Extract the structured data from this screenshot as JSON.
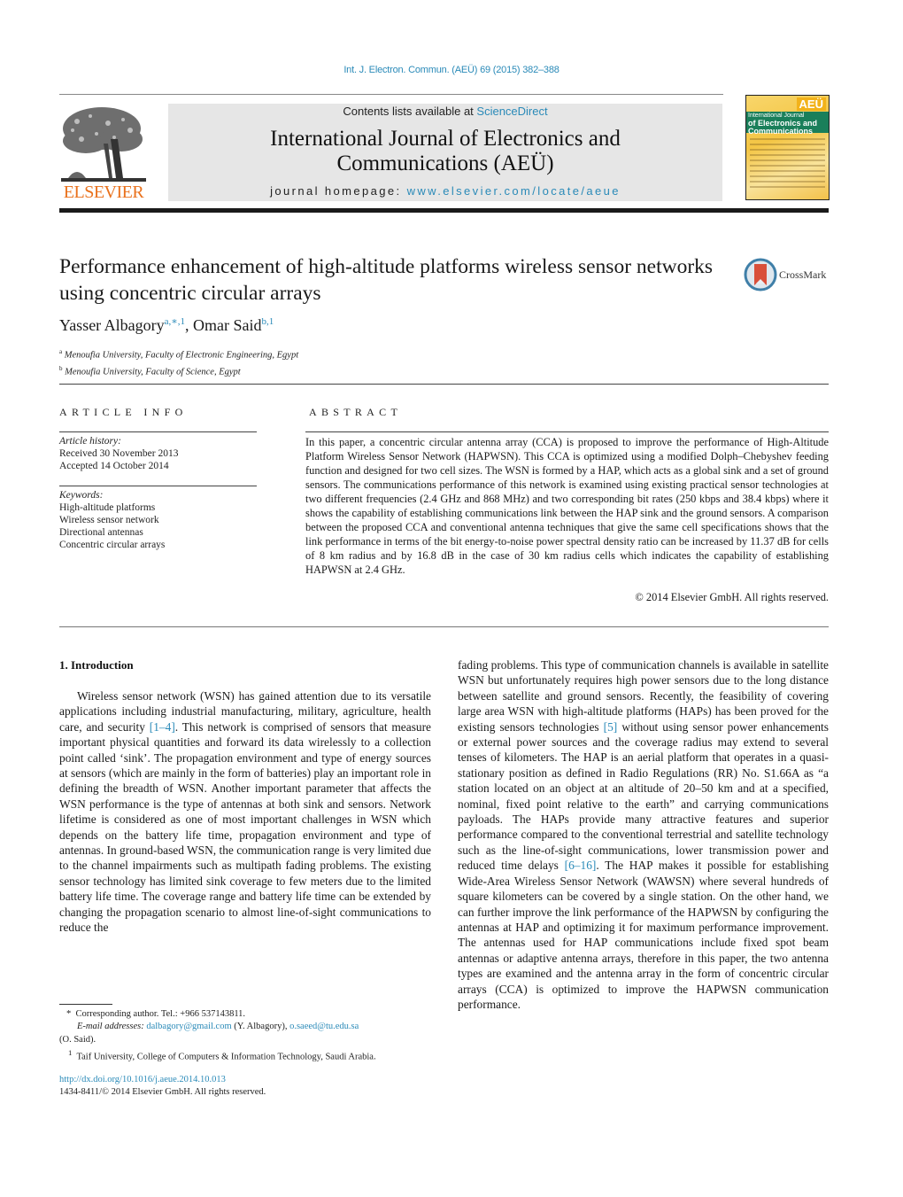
{
  "header": {
    "citation": "Int. J. Electron. Commun. (AEÜ) 69 (2015) 382–388",
    "contents_prefix": "Contents lists available at ",
    "contents_link": "ScienceDirect",
    "journal_title_line1": "International Journal of Electronics and",
    "journal_title_line2": "Communications (AEÜ)",
    "homepage_prefix": "journal homepage: ",
    "homepage_link": "www.elsevier.com/locate/aeue",
    "publisher_logo_text": "ELSEVIER",
    "cover": {
      "badge": "AEÜ",
      "small_title": "International Journal",
      "big_title_line1": "of Electronics and",
      "big_title_line2": "Communications"
    }
  },
  "article": {
    "title": "Performance enhancement of high-altitude platforms wireless sensor networks using concentric circular arrays",
    "crossmark_label": "CrossMark",
    "authors": [
      {
        "name": "Yasser Albagory",
        "marks": "a,∗,1"
      },
      {
        "name": "Omar Said",
        "marks": "b,1"
      }
    ],
    "author_separator": ", ",
    "affiliations": [
      {
        "mark": "a",
        "text": "Menoufia University, Faculty of Electronic Engineering, Egypt"
      },
      {
        "mark": "b",
        "text": "Menoufia University, Faculty of Science, Egypt"
      }
    ]
  },
  "article_info": {
    "heading": "ARTICLE INFO",
    "history_label": "Article history:",
    "received": "Received 30 November 2013",
    "accepted": "Accepted 14 October 2014",
    "keywords_label": "Keywords:",
    "keywords": [
      "High-altitude platforms",
      "Wireless sensor network",
      "Directional antennas",
      "Concentric circular arrays"
    ]
  },
  "abstract": {
    "heading": "ABSTRACT",
    "text": "In this paper, a concentric circular antenna array (CCA) is proposed to improve the performance of High-Altitude Platform Wireless Sensor Network (HAPWSN). This CCA is optimized using a modified Dolph–Chebyshev feeding function and designed for two cell sizes. The WSN is formed by a HAP, which acts as a global sink and a set of ground sensors. The communications performance of this network is examined using existing practical sensor technologies at two different frequencies (2.4 GHz and 868 MHz) and two corresponding bit rates (250 kbps and 38.4 kbps) where it shows the capability of establishing communications link between the HAP sink and the ground sensors. A comparison between the proposed CCA and conventional antenna techniques that give the same cell specifications shows that the link performance in terms of the bit energy-to-noise power spectral density ratio can be increased by 11.37 dB for cells of 8 km radius and by 16.8 dB in the case of 30 km radius cells which indicates the capability of establishing HAPWSN at 2.4 GHz.",
    "copyright": "© 2014 Elsevier GmbH. All rights reserved."
  },
  "body": {
    "section_heading": "1.  Introduction",
    "left_column": {
      "p1_part1": "Wireless sensor network (WSN) has gained attention due to its versatile applications including industrial manufacturing, military, agriculture, health care, and security ",
      "ref1": "[1–4]",
      "p1_part2": ". This network is comprised of sensors that measure important physical quantities and forward its data wirelessly to a collection point called ‘sink’. The propagation environment and type of energy sources at sensors (which are mainly in the form of batteries) play an important role in defining the breadth of WSN. Another important parameter that affects the WSN performance is the type of antennas at both sink and sensors. Network lifetime is considered as one of most important challenges in WSN which depends on the battery life time, propagation environment and type of antennas. In ground-based WSN, the communication range is very limited due to the channel impairments such as multipath fading problems. The existing sensor technology has limited sink coverage to few meters due to the limited battery life time. The coverage range and battery life time can be extended by changing the propagation scenario to almost line-of-sight communications to reduce the"
    },
    "right_column": {
      "part1": "fading problems. This type of communication channels is available in satellite WSN but unfortunately requires high power sensors due to the long distance between satellite and ground sensors. Recently, the feasibility of covering large area WSN with high-altitude platforms (HAPs) has been proved for the existing sensors technologies ",
      "ref5": "[5]",
      "part2": " without using sensor power enhancements or external power sources and the coverage radius may extend to several tenses of kilometers. The HAP is an aerial platform that operates in a quasi-stationary position as defined in Radio Regulations (RR) No. S1.66A as “a station located on an object at an altitude of 20–50 km and at a specified, nominal, fixed point relative to the earth” and carrying communications payloads. The HAPs provide many attractive features and superior performance compared to the conventional terrestrial and satellite technology such as the line-of-sight communications, lower transmission power and reduced time delays ",
      "ref6": "[6–16]",
      "part3": ". The HAP makes it possible for establishing Wide-Area Wireless Sensor Network (WAWSN) where several hundreds of square kilometers can be covered by a single station. On the other hand, we can further improve the link performance of the HAPWSN by configuring the antennas at HAP and optimizing it for maximum performance improvement. The antennas used for HAP communications include fixed spot beam antennas or adaptive antenna arrays, therefore in this paper, the two antenna types are examined and the antenna array in the form of concentric circular arrays (CCA) is optimized to improve the HAPWSN communication performance."
    }
  },
  "footnotes": {
    "corresponding_mark": "*",
    "corresponding": "Corresponding author. Tel.: +966 537143811.",
    "email_label": "E-mail addresses:",
    "email1": "dalbagory@gmail.com",
    "email1_owner": " (Y. Albagory), ",
    "email2": "o.saeed@tu.edu.sa",
    "email2_owner": "(O. Said).",
    "note1_mark": "1",
    "note1": "Taif University, College of Computers & Information Technology, Saudi Arabia.",
    "doi_link": "http://dx.doi.org/10.1016/j.aeue.2014.10.013",
    "issn_line": "1434-8411/© 2014 Elsevier GmbH. All rights reserved."
  },
  "colors": {
    "link": "#2a8ab8",
    "elsevier_orange": "#e9711c",
    "header_band": "#e6e6e6"
  }
}
